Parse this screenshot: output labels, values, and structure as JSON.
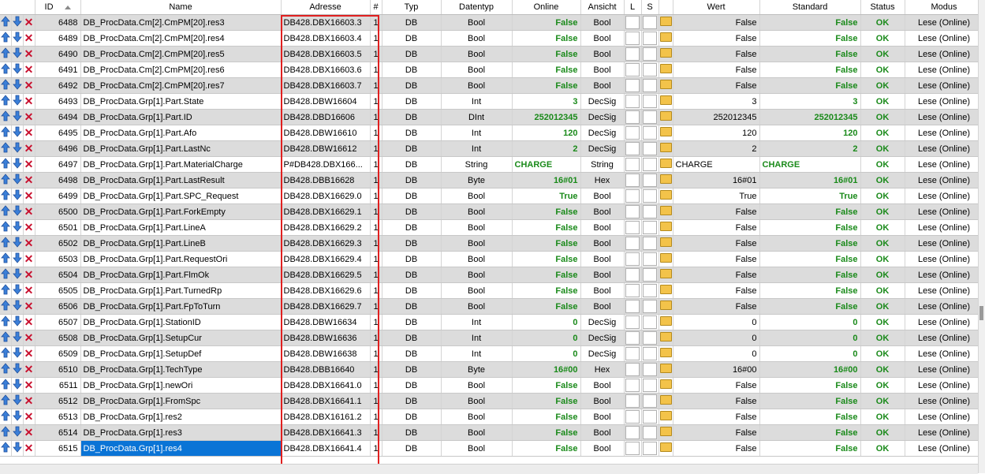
{
  "columns": {
    "id": "ID",
    "name": "Name",
    "adresse": "Adresse",
    "hash": "#",
    "typ": "Typ",
    "datentyp": "Datentyp",
    "online": "Online",
    "ansicht": "Ansicht",
    "l": "L",
    "s": "S",
    "wert": "Wert",
    "standard": "Standard",
    "status": "Status",
    "modus": "Modus"
  },
  "icons": {
    "upload": "upload-arrow-icon",
    "download": "download-arrow-icon",
    "delete": "delete-x-icon",
    "folder": "folder-open-icon"
  },
  "colors": {
    "value_green": "#1a8a1a",
    "selection": "#0a74d6",
    "highlight_box": "#e02020",
    "alt_row": "#dcdcdc"
  },
  "selected_row_id": "6515",
  "rows": [
    {
      "id": "6488",
      "name": "DB_ProcData.Cm[2].CmPM[20].res3",
      "adresse": "DB428.DBX16603.3",
      "n": "1",
      "typ": "DB",
      "datentyp": "Bool",
      "online": "False",
      "ansicht": "Bool",
      "wert": "False",
      "standard": "False",
      "status": "OK",
      "modus": "Lese (Online)"
    },
    {
      "id": "6489",
      "name": "DB_ProcData.Cm[2].CmPM[20].res4",
      "adresse": "DB428.DBX16603.4",
      "n": "1",
      "typ": "DB",
      "datentyp": "Bool",
      "online": "False",
      "ansicht": "Bool",
      "wert": "False",
      "standard": "False",
      "status": "OK",
      "modus": "Lese (Online)"
    },
    {
      "id": "6490",
      "name": "DB_ProcData.Cm[2].CmPM[20].res5",
      "adresse": "DB428.DBX16603.5",
      "n": "1",
      "typ": "DB",
      "datentyp": "Bool",
      "online": "False",
      "ansicht": "Bool",
      "wert": "False",
      "standard": "False",
      "status": "OK",
      "modus": "Lese (Online)"
    },
    {
      "id": "6491",
      "name": "DB_ProcData.Cm[2].CmPM[20].res6",
      "adresse": "DB428.DBX16603.6",
      "n": "1",
      "typ": "DB",
      "datentyp": "Bool",
      "online": "False",
      "ansicht": "Bool",
      "wert": "False",
      "standard": "False",
      "status": "OK",
      "modus": "Lese (Online)"
    },
    {
      "id": "6492",
      "name": "DB_ProcData.Cm[2].CmPM[20].res7",
      "adresse": "DB428.DBX16603.7",
      "n": "1",
      "typ": "DB",
      "datentyp": "Bool",
      "online": "False",
      "ansicht": "Bool",
      "wert": "False",
      "standard": "False",
      "status": "OK",
      "modus": "Lese (Online)"
    },
    {
      "id": "6493",
      "name": "DB_ProcData.Grp[1].Part.State",
      "adresse": "DB428.DBW16604",
      "n": "1",
      "typ": "DB",
      "datentyp": "Int",
      "online": "3",
      "ansicht": "DecSig",
      "wert": "3",
      "standard": "3",
      "status": "OK",
      "modus": "Lese (Online)"
    },
    {
      "id": "6494",
      "name": "DB_ProcData.Grp[1].Part.ID",
      "adresse": "DB428.DBD16606",
      "n": "1",
      "typ": "DB",
      "datentyp": "DInt",
      "online": "252012345",
      "ansicht": "DecSig",
      "wert": "252012345",
      "standard": "252012345",
      "status": "OK",
      "modus": "Lese (Online)"
    },
    {
      "id": "6495",
      "name": "DB_ProcData.Grp[1].Part.Afo",
      "adresse": "DB428.DBW16610",
      "n": "1",
      "typ": "DB",
      "datentyp": "Int",
      "online": "120",
      "ansicht": "DecSig",
      "wert": "120",
      "standard": "120",
      "status": "OK",
      "modus": "Lese (Online)"
    },
    {
      "id": "6496",
      "name": "DB_ProcData.Grp[1].Part.LastNc",
      "adresse": "DB428.DBW16612",
      "n": "1",
      "typ": "DB",
      "datentyp": "Int",
      "online": "2",
      "ansicht": "DecSig",
      "wert": "2",
      "standard": "2",
      "status": "OK",
      "modus": "Lese (Online)"
    },
    {
      "id": "6497",
      "name": "DB_ProcData.Grp[1].Part.MaterialCharge",
      "adresse": "P#DB428.DBX166...",
      "n": "1",
      "typ": "DB",
      "datentyp": "String",
      "online": "CHARGE",
      "ansicht": "String",
      "wert": "CHARGE",
      "standard": "CHARGE",
      "status": "OK",
      "modus": "Lese (Online)",
      "left": true
    },
    {
      "id": "6498",
      "name": "DB_ProcData.Grp[1].Part.LastResult",
      "adresse": "DB428.DBB16628",
      "n": "1",
      "typ": "DB",
      "datentyp": "Byte",
      "online": "16#01",
      "ansicht": "Hex",
      "wert": "16#01",
      "standard": "16#01",
      "status": "OK",
      "modus": "Lese (Online)"
    },
    {
      "id": "6499",
      "name": "DB_ProcData.Grp[1].Part.SPC_Request",
      "adresse": "DB428.DBX16629.0",
      "n": "1",
      "typ": "DB",
      "datentyp": "Bool",
      "online": "True",
      "ansicht": "Bool",
      "wert": "True",
      "standard": "True",
      "status": "OK",
      "modus": "Lese (Online)"
    },
    {
      "id": "6500",
      "name": "DB_ProcData.Grp[1].Part.ForkEmpty",
      "adresse": "DB428.DBX16629.1",
      "n": "1",
      "typ": "DB",
      "datentyp": "Bool",
      "online": "False",
      "ansicht": "Bool",
      "wert": "False",
      "standard": "False",
      "status": "OK",
      "modus": "Lese (Online)"
    },
    {
      "id": "6501",
      "name": "DB_ProcData.Grp[1].Part.LineA",
      "adresse": "DB428.DBX16629.2",
      "n": "1",
      "typ": "DB",
      "datentyp": "Bool",
      "online": "False",
      "ansicht": "Bool",
      "wert": "False",
      "standard": "False",
      "status": "OK",
      "modus": "Lese (Online)"
    },
    {
      "id": "6502",
      "name": "DB_ProcData.Grp[1].Part.LineB",
      "adresse": "DB428.DBX16629.3",
      "n": "1",
      "typ": "DB",
      "datentyp": "Bool",
      "online": "False",
      "ansicht": "Bool",
      "wert": "False",
      "standard": "False",
      "status": "OK",
      "modus": "Lese (Online)"
    },
    {
      "id": "6503",
      "name": "DB_ProcData.Grp[1].Part.RequestOri",
      "adresse": "DB428.DBX16629.4",
      "n": "1",
      "typ": "DB",
      "datentyp": "Bool",
      "online": "False",
      "ansicht": "Bool",
      "wert": "False",
      "standard": "False",
      "status": "OK",
      "modus": "Lese (Online)"
    },
    {
      "id": "6504",
      "name": "DB_ProcData.Grp[1].Part.FlmOk",
      "adresse": "DB428.DBX16629.5",
      "n": "1",
      "typ": "DB",
      "datentyp": "Bool",
      "online": "False",
      "ansicht": "Bool",
      "wert": "False",
      "standard": "False",
      "status": "OK",
      "modus": "Lese (Online)"
    },
    {
      "id": "6505",
      "name": "DB_ProcData.Grp[1].Part.TurnedRp",
      "adresse": "DB428.DBX16629.6",
      "n": "1",
      "typ": "DB",
      "datentyp": "Bool",
      "online": "False",
      "ansicht": "Bool",
      "wert": "False",
      "standard": "False",
      "status": "OK",
      "modus": "Lese (Online)"
    },
    {
      "id": "6506",
      "name": "DB_ProcData.Grp[1].Part.FpToTurn",
      "adresse": "DB428.DBX16629.7",
      "n": "1",
      "typ": "DB",
      "datentyp": "Bool",
      "online": "False",
      "ansicht": "Bool",
      "wert": "False",
      "standard": "False",
      "status": "OK",
      "modus": "Lese (Online)"
    },
    {
      "id": "6507",
      "name": "DB_ProcData.Grp[1].StationID",
      "adresse": "DB428.DBW16634",
      "n": "1",
      "typ": "DB",
      "datentyp": "Int",
      "online": "0",
      "ansicht": "DecSig",
      "wert": "0",
      "standard": "0",
      "status": "OK",
      "modus": "Lese (Online)"
    },
    {
      "id": "6508",
      "name": "DB_ProcData.Grp[1].SetupCur",
      "adresse": "DB428.DBW16636",
      "n": "1",
      "typ": "DB",
      "datentyp": "Int",
      "online": "0",
      "ansicht": "DecSig",
      "wert": "0",
      "standard": "0",
      "status": "OK",
      "modus": "Lese (Online)"
    },
    {
      "id": "6509",
      "name": "DB_ProcData.Grp[1].SetupDef",
      "adresse": "DB428.DBW16638",
      "n": "1",
      "typ": "DB",
      "datentyp": "Int",
      "online": "0",
      "ansicht": "DecSig",
      "wert": "0",
      "standard": "0",
      "status": "OK",
      "modus": "Lese (Online)"
    },
    {
      "id": "6510",
      "name": "DB_ProcData.Grp[1].TechType",
      "adresse": "DB428.DBB16640",
      "n": "1",
      "typ": "DB",
      "datentyp": "Byte",
      "online": "16#00",
      "ansicht": "Hex",
      "wert": "16#00",
      "standard": "16#00",
      "status": "OK",
      "modus": "Lese (Online)"
    },
    {
      "id": "6511",
      "name": "DB_ProcData.Grp[1].newOri",
      "adresse": "DB428.DBX16641.0",
      "n": "1",
      "typ": "DB",
      "datentyp": "Bool",
      "online": "False",
      "ansicht": "Bool",
      "wert": "False",
      "standard": "False",
      "status": "OK",
      "modus": "Lese (Online)"
    },
    {
      "id": "6512",
      "name": "DB_ProcData.Grp[1].FromSpc",
      "adresse": "DB428.DBX16641.1",
      "n": "1",
      "typ": "DB",
      "datentyp": "Bool",
      "online": "False",
      "ansicht": "Bool",
      "wert": "False",
      "standard": "False",
      "status": "OK",
      "modus": "Lese (Online)"
    },
    {
      "id": "6513",
      "name": "DB_ProcData.Grp[1].res2",
      "adresse": "DB428.DBX16161.2",
      "n": "1",
      "typ": "DB",
      "datentyp": "Bool",
      "online": "False",
      "ansicht": "Bool",
      "wert": "False",
      "standard": "False",
      "status": "OK",
      "modus": "Lese (Online)"
    },
    {
      "id": "6514",
      "name": "DB_ProcData.Grp[1].res3",
      "adresse": "DB428.DBX16641.3",
      "n": "1",
      "typ": "DB",
      "datentyp": "Bool",
      "online": "False",
      "ansicht": "Bool",
      "wert": "False",
      "standard": "False",
      "status": "OK",
      "modus": "Lese (Online)"
    },
    {
      "id": "6515",
      "name": "DB_ProcData.Grp[1].res4",
      "adresse": "DB428.DBX16641.4",
      "n": "1",
      "typ": "DB",
      "datentyp": "Bool",
      "online": "False",
      "ansicht": "Bool",
      "wert": "False",
      "standard": "False",
      "status": "OK",
      "modus": "Lese (Online)"
    }
  ]
}
